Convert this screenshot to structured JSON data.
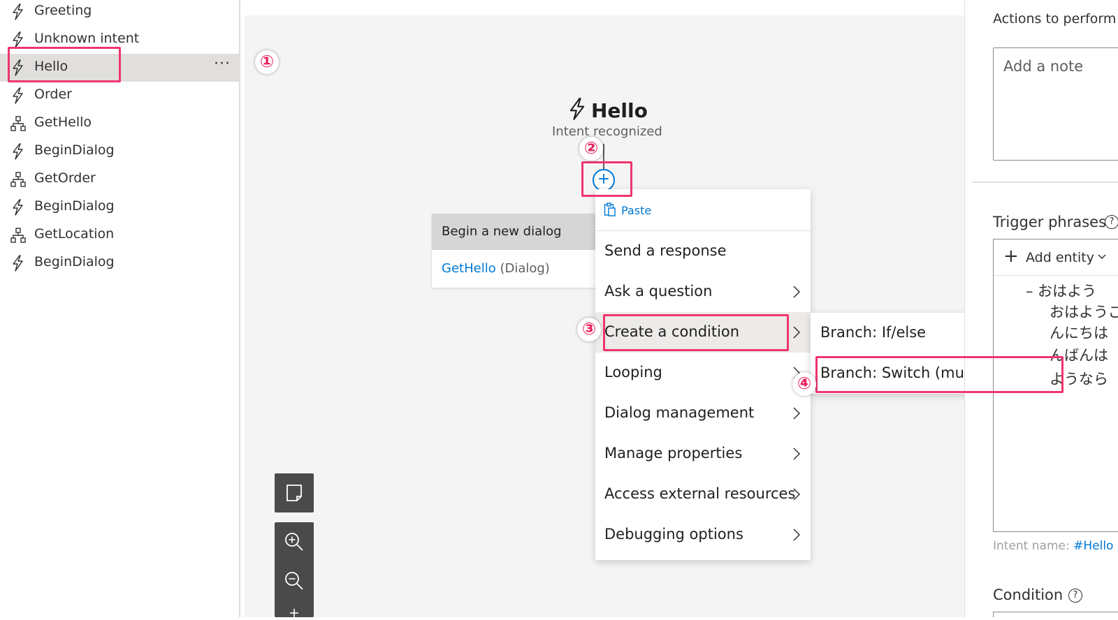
{
  "sidebar": {
    "items": [
      {
        "label": "Greeting",
        "icon": "lightning-icon"
      },
      {
        "label": "Unknown intent",
        "icon": "lightning-icon"
      },
      {
        "label": "Hello",
        "icon": "lightning-icon",
        "selected": true
      },
      {
        "label": "Order",
        "icon": "lightning-icon"
      },
      {
        "label": "GetHello",
        "icon": "dialog-tree-icon"
      },
      {
        "label": "BeginDialog",
        "icon": "lightning-icon"
      },
      {
        "label": "GetOrder",
        "icon": "dialog-tree-icon"
      },
      {
        "label": "BeginDialog",
        "icon": "lightning-icon"
      },
      {
        "label": "GetLocation",
        "icon": "dialog-tree-icon"
      },
      {
        "label": "BeginDialog",
        "icon": "lightning-icon"
      }
    ],
    "more_label": "···"
  },
  "canvas": {
    "trigger_title": "Hello",
    "trigger_subtitle": "Intent recognized",
    "add_label": "+",
    "begin_dialog": {
      "header": "Begin a new dialog",
      "link": "GetHello",
      "type": "(Dialog)"
    }
  },
  "menu": {
    "paste": "Paste",
    "items": [
      {
        "label": "Send a response",
        "submenu": false
      },
      {
        "label": "Ask a question",
        "submenu": true
      },
      {
        "label": "Create a condition",
        "submenu": true
      },
      {
        "label": "Looping",
        "submenu": true
      },
      {
        "label": "Dialog management",
        "submenu": true
      },
      {
        "label": "Manage properties",
        "submenu": true
      },
      {
        "label": "Access external resources",
        "submenu": true
      },
      {
        "label": "Debugging options",
        "submenu": true
      }
    ],
    "submenu": [
      "Branch: If/else",
      "Branch: Switch (multiple options)"
    ]
  },
  "right_panel": {
    "actions_text": "Actions to perform w",
    "note_placeholder": "Add a note",
    "trigger_phrases_label": "Trigger phrases",
    "add_entity": "Add entity",
    "phrases": [
      "– おはよう",
      "おはようご",
      "んにちは",
      "んばんは",
      "ようなら"
    ],
    "intent_name_label": "Intent name:",
    "intent_name_value": "#Hello",
    "condition_label": "Condition",
    "help_glyph": "?"
  },
  "annotations": [
    "①",
    "②",
    "③",
    "④"
  ],
  "colors": {
    "accent": "#0078d4",
    "highlight": "#f0356e",
    "selected": "#e1dfdd"
  }
}
